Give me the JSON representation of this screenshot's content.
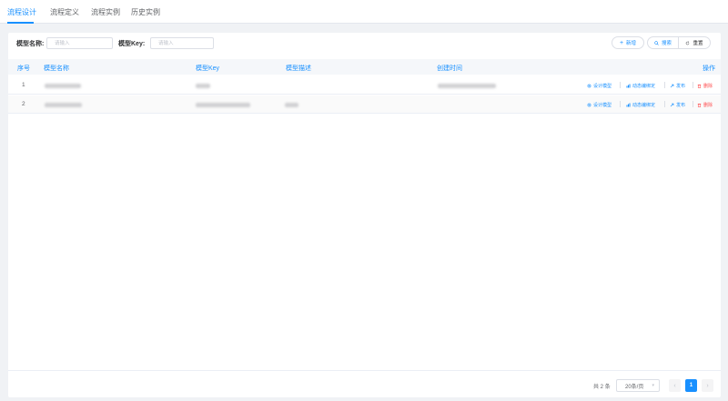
{
  "tabs": [
    {
      "label": "流程设计",
      "active": true
    },
    {
      "label": "流程定义",
      "active": false
    },
    {
      "label": "流程实例",
      "active": false
    },
    {
      "label": "历史实例",
      "active": false
    }
  ],
  "search": {
    "model_name_label": "模型名称:",
    "model_name_placeholder": "请输入",
    "model_key_label": "模型Key:",
    "model_key_placeholder": "请输入"
  },
  "toolbar": {
    "add_label": "新增",
    "search_label": "搜索",
    "reset_label": "重置"
  },
  "table": {
    "columns": [
      "序号",
      "模型名称",
      "模型Key",
      "模型描述",
      "创建时间",
      "操作"
    ],
    "rows": [
      {
        "index": "1"
      },
      {
        "index": "2"
      }
    ],
    "actions": {
      "design": "设计模型",
      "dynamic": "动态编绑定",
      "publish": "发布",
      "delete": "删除"
    }
  },
  "pagination": {
    "total_text": "共 2 条",
    "page_size": "20条/页",
    "current_page": "1",
    "prev": "‹",
    "next": "›"
  },
  "colors": {
    "accent": "#1890ff",
    "danger": "#ff4d4f"
  }
}
